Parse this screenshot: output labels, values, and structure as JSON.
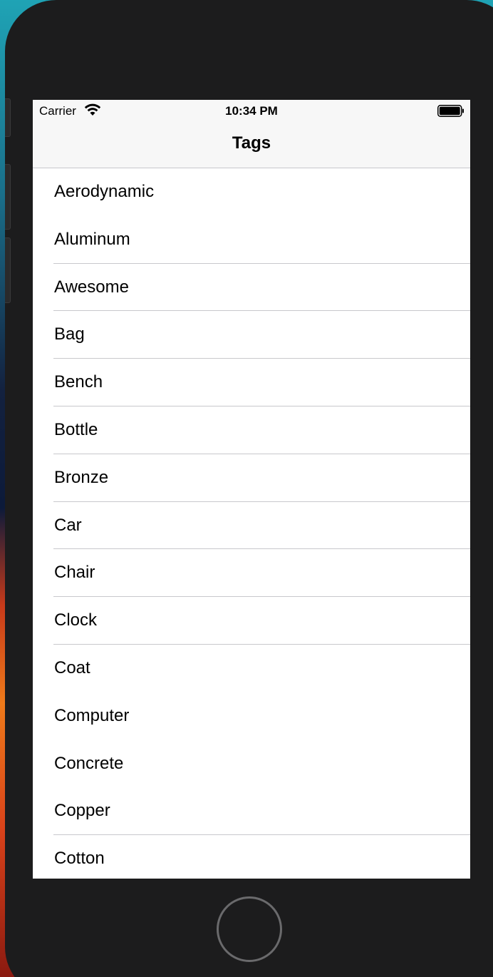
{
  "status_bar": {
    "carrier": "Carrier",
    "time": "10:34 PM",
    "wifi_icon": "wifi-icon",
    "battery_icon": "battery-icon"
  },
  "nav": {
    "title": "Tags"
  },
  "tags": [
    {
      "label": "Aerodynamic",
      "separator": false
    },
    {
      "label": "Aluminum",
      "separator": true
    },
    {
      "label": "Awesome",
      "separator": true
    },
    {
      "label": "Bag",
      "separator": true
    },
    {
      "label": "Bench",
      "separator": true
    },
    {
      "label": "Bottle",
      "separator": true
    },
    {
      "label": "Bronze",
      "separator": true
    },
    {
      "label": "Car",
      "separator": true
    },
    {
      "label": "Chair",
      "separator": true
    },
    {
      "label": "Clock",
      "separator": true
    },
    {
      "label": "Coat",
      "separator": false
    },
    {
      "label": "Computer",
      "separator": false
    },
    {
      "label": "Concrete",
      "separator": false
    },
    {
      "label": "Copper",
      "separator": true
    },
    {
      "label": "Cotton",
      "separator": false
    }
  ],
  "device": {
    "home_button_icon": "home-button-icon"
  },
  "colors": {
    "bar_background": "#f7f7f7",
    "separator": "#c8c8cc",
    "text": "#000000",
    "bezel": "#1c1c1d"
  }
}
